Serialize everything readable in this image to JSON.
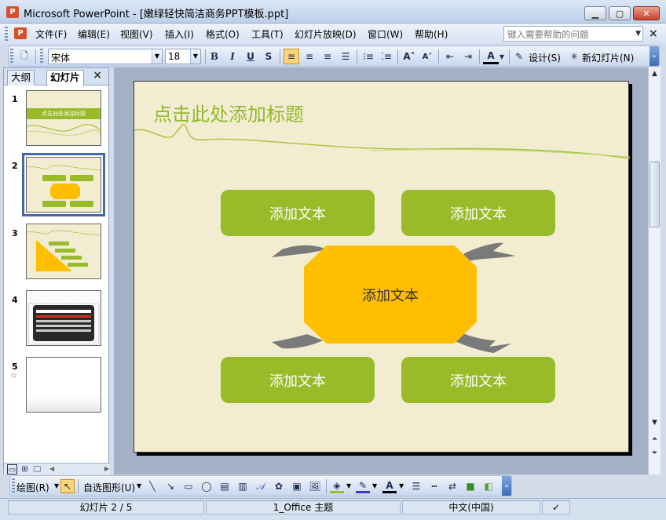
{
  "window": {
    "app_icon": "powerpoint-icon",
    "title": "Microsoft PowerPoint - [嫩绿轻快简洁商务PPT模板.ppt]"
  },
  "menubar": {
    "items": [
      "文件(F)",
      "编辑(E)",
      "视图(V)",
      "插入(I)",
      "格式(O)",
      "工具(T)",
      "幻灯片放映(D)",
      "窗口(W)",
      "帮助(H)"
    ],
    "help_placeholder": "键入需要帮助的问题"
  },
  "format_toolbar": {
    "font_name": "宋体",
    "font_size": "18",
    "bold": "B",
    "italic": "I",
    "underline": "U",
    "shadow": "S",
    "design_label": "设计(S)",
    "new_slide_label": "新幻灯片(N)"
  },
  "side_panel": {
    "tabs": [
      "大纲",
      "幻灯片"
    ],
    "active_tab": "幻灯片",
    "close_glyph": "×",
    "thumbnails": [
      {
        "number": "1",
        "title": "点击此处添加标题"
      },
      {
        "number": "2"
      },
      {
        "number": "3"
      },
      {
        "number": "4"
      },
      {
        "number": "5"
      }
    ],
    "selected_thumbnail": 2
  },
  "slide": {
    "title": "点击此处添加标题",
    "boxes": {
      "top_left": "添加文本",
      "top_right": "添加文本",
      "center": "添加文本",
      "bottom_left": "添加文本",
      "bottom_right": "添加文本"
    },
    "colors": {
      "background": "#f2ecd0",
      "green": "#99ba29",
      "orange": "#ffbf00",
      "arrow": "#777777"
    }
  },
  "drawing_toolbar": {
    "draw_label": "绘图(R)",
    "autoshapes_label": "自选图形(U)"
  },
  "statusbar": {
    "slide_position": "幻灯片 2 / 5",
    "theme": "1_Office 主题",
    "language": "中文(中国)"
  }
}
